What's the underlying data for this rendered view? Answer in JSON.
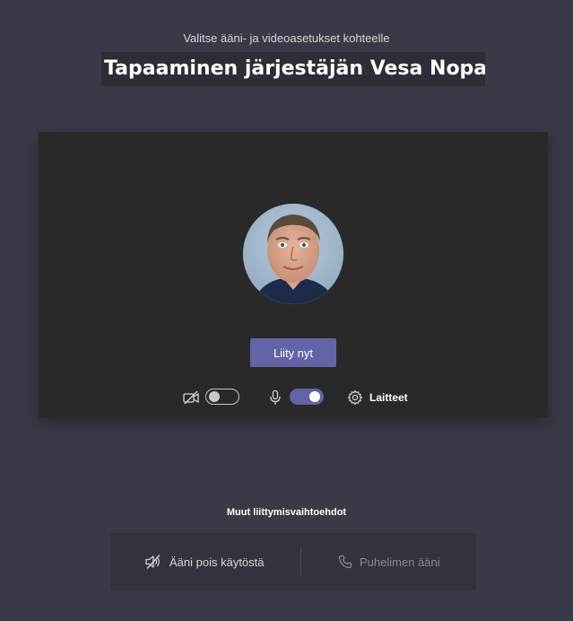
{
  "header": {
    "subtitle": "Valitse ääni- ja videoasetukset kohteelle",
    "title": "Tapaaminen järjestäjän Vesa Nopanen"
  },
  "preview": {
    "join_button": "Liity nyt",
    "video_toggle": {
      "icon": "camera-off-icon",
      "on": false
    },
    "mic_toggle": {
      "icon": "microphone-icon",
      "on": true
    },
    "devices": {
      "icon": "gear-icon",
      "label": "Laitteet"
    }
  },
  "other_options": {
    "heading": "Muut liittymisvaihtoehdot",
    "audio_off": {
      "icon": "speaker-off-icon",
      "label": "Ääni pois käytöstä"
    },
    "phone_audio": {
      "icon": "phone-icon",
      "label": "Puhelimen ääni"
    }
  },
  "colors": {
    "background": "#3a3947",
    "panel": "#292929",
    "accent": "#6264a7"
  }
}
